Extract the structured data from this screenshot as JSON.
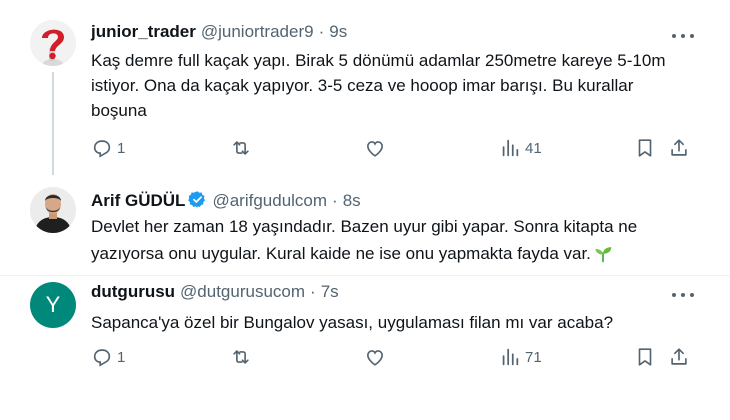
{
  "tweets": [
    {
      "display_name": "junior_trader",
      "handle": "@juniortrader9",
      "separator": "·",
      "time": "9s",
      "text": "Kaş demre full kaçak yapı. Birak 5 dönümü adamlar 250metre kareye 5-10m istiyor. Ona da kaçak yapıyor. 3-5 ceza ve hooop imar barışı. Bu kurallar boşuna",
      "replies": "1",
      "views": "41",
      "avatar_icon": "question-mark-avatar"
    },
    {
      "display_name": "Arif GÜDÜL",
      "handle": "@arifgudulcom",
      "separator": "·",
      "time": "8s",
      "verified": true,
      "text": "Devlet her zaman 18 yaşındadır. Bazen uyur gibi yapar. Sonra kitapta ne yazıyorsa onu uygular. Kural kaide ne ise onu yapmakta fayda var.",
      "emoji": "seedling-icon",
      "avatar_icon": "person-photo-avatar"
    },
    {
      "display_name": "dutgurusu",
      "handle": "@dutgurusucom",
      "separator": "·",
      "time": "7s",
      "text": "Sapanca'ya özel bir Bungalov yasası, uygulaması filan mı var acaba?",
      "replies": "1",
      "views": "71",
      "avatar_letter": "Y",
      "avatar_color": "#00897b"
    }
  ],
  "colors": {
    "text": "#0f1419",
    "secondary": "#536471",
    "verified": "#1d9bf0",
    "thread_line": "#cfd9de"
  }
}
